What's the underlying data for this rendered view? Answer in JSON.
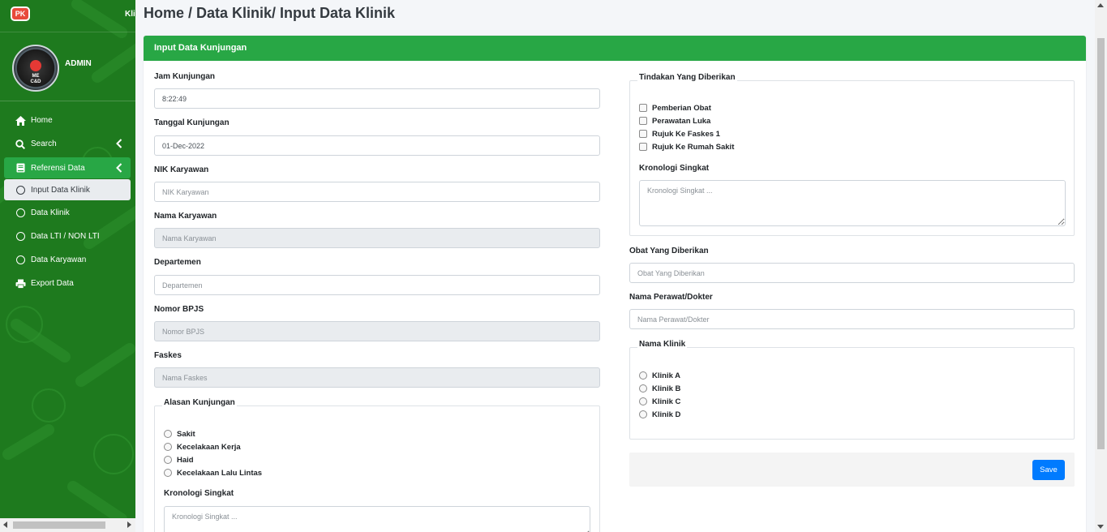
{
  "brand": {
    "logo_text": "PK",
    "name": "Kli"
  },
  "user": {
    "name": "ADMIN",
    "avatar_text": "ME\nC&D"
  },
  "breadcrumb": "Home / Data Klinik/ Input Data Klinik",
  "nav": {
    "home": "Home",
    "search": "Search",
    "referensi": "Referensi Data",
    "input_klinik": "Input Data Klinik",
    "data_klinik": "Data Klinik",
    "data_lti": "Data LTI / NON LTI",
    "data_karyawan": "Data Karyawan",
    "export": "Export Data"
  },
  "card": {
    "title": "Input Data Kunjungan"
  },
  "form": {
    "jam_label": "Jam Kunjungan",
    "jam_value": "8:22:49",
    "tanggal_label": "Tanggal Kunjungan",
    "tanggal_value": "01-Dec-2022",
    "nik_label": "NIK Karyawan",
    "nik_placeholder": "NIK Karyawan",
    "nama_label": "Nama Karyawan",
    "nama_placeholder": "Nama Karyawan",
    "departemen_label": "Departemen",
    "departemen_placeholder": "Departemen",
    "bpjs_label": "Nomor BPJS",
    "bpjs_placeholder": "Nomor BPJS",
    "faskes_label": "Faskes",
    "faskes_placeholder": "Nama Faskes",
    "alasan_legend": "Alasan Kunjungan",
    "alasan_options": [
      "Sakit",
      "Kecelakaan Kerja",
      "Haid",
      "Kecelakaan Lalu Lintas"
    ],
    "kronologi_label": "Kronologi Singkat",
    "kronologi_placeholder": "Kronologi Singkat ...",
    "tindakan_legend": "Tindakan Yang Diberikan",
    "tindakan_options": [
      "Pemberian Obat",
      "Perawatan Luka",
      "Rujuk Ke Faskes 1",
      "Rujuk Ke Rumah Sakit"
    ],
    "kronologi2_label": "Kronologi Singkat",
    "kronologi2_placeholder": "Kronologi Singkat ...",
    "obat_label": "Obat Yang Diberikan",
    "obat_placeholder": "Obat Yang Diberikan",
    "perawat_label": "Nama Perawat/Dokter",
    "perawat_placeholder": "Nama Perawat/Dokter",
    "klinik_legend": "Nama Klinik",
    "klinik_options": [
      "Klinik A",
      "Klinik B",
      "Klinik C",
      "Klinik D"
    ],
    "save_label": "Save"
  },
  "colors": {
    "sidebar": "#1e7a1e",
    "accent": "#28a745",
    "primary": "#007bff"
  }
}
